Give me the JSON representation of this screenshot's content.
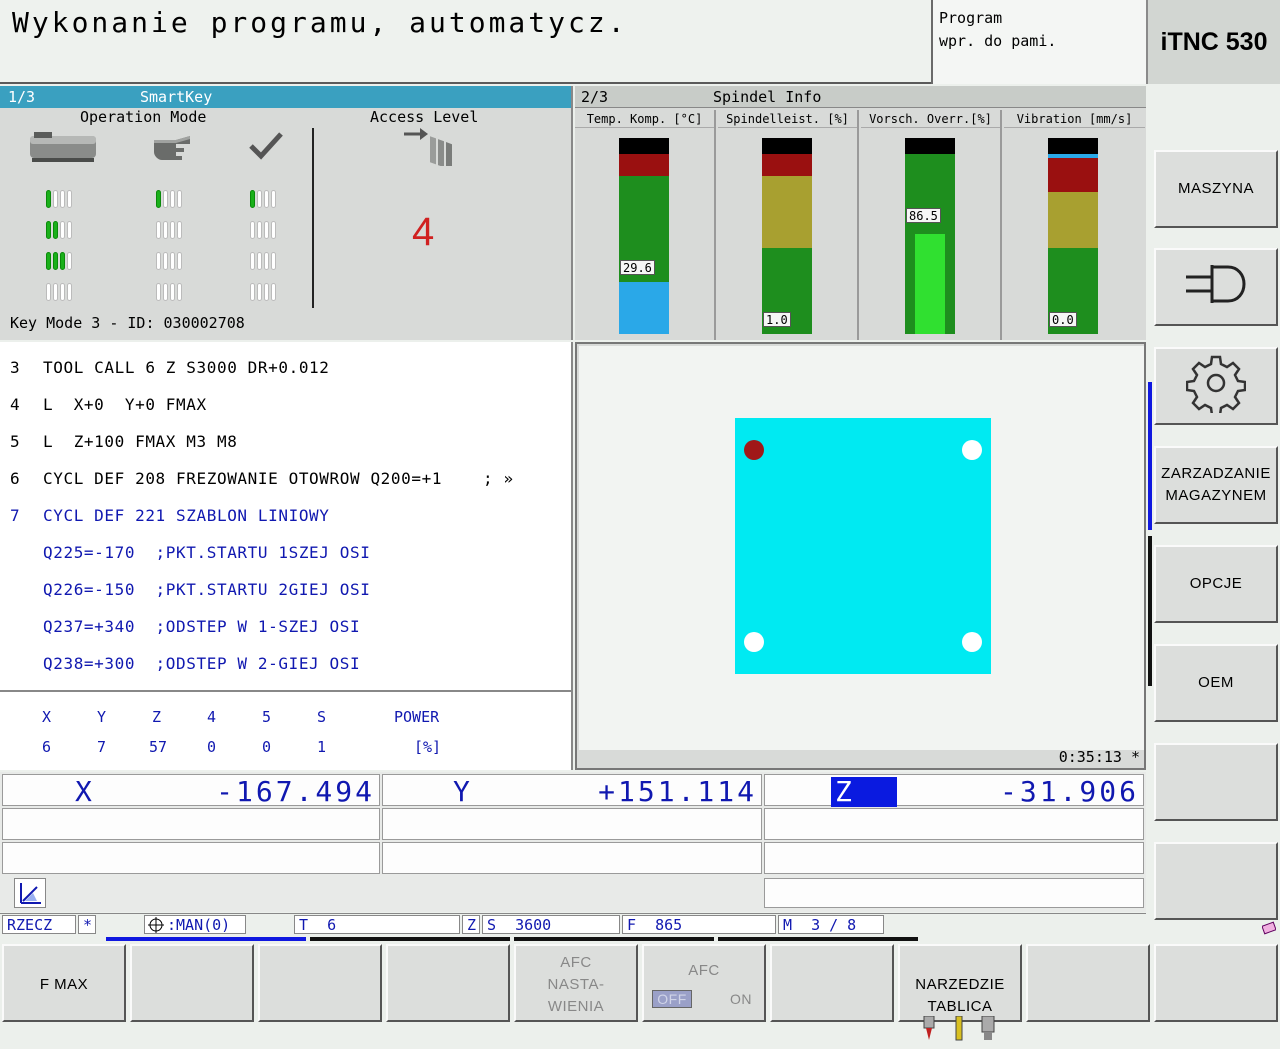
{
  "header": {
    "mode_title": "Wykonanie programu, automatycz.",
    "program_line1": "Program",
    "program_line2": "wpr. do pami.",
    "logo": "iTNC 530"
  },
  "smartkey": {
    "title_page": "1/3",
    "title": "SmartKey",
    "operation_mode_label": "Operation Mode",
    "access_level_label": "Access Level",
    "access_level_value": "4",
    "key_mode": "Key Mode 3 - ID: 030002708",
    "icons": [
      "machine-icon",
      "hand-icon",
      "check-icon",
      "key-arrow-icon"
    ]
  },
  "spindle": {
    "title_page": "2/3",
    "title": "Spindel Info",
    "gauges": [
      {
        "label": "Temp. Komp. [°C]",
        "value": "29.6"
      },
      {
        "label": "Spindelleist. [%]",
        "value": "1.0"
      },
      {
        "label": "Vorsch. Overr.[%]",
        "value": "86.5"
      },
      {
        "label": "Vibration [mm/s]",
        "value": "0.0"
      }
    ]
  },
  "program": {
    "lines": [
      {
        "no": "3",
        "text": "TOOL CALL 6 Z S3000 DR+0.012",
        "blue": false
      },
      {
        "no": "4",
        "text": "L  X+0  Y+0 FMAX",
        "blue": false
      },
      {
        "no": "5",
        "text": "L  Z+100 FMAX M3 M8",
        "blue": false
      },
      {
        "no": "6",
        "text": "CYCL DEF 208 FREZOWANIE OTOWROW Q200=+1    ; »",
        "blue": false
      },
      {
        "no": "7",
        "text": "CYCL DEF 221 SZABLON LINIOWY",
        "blue": true
      },
      {
        "no": "",
        "text": "Q225=-170  ;PKT.STARTU 1SZEJ OSI",
        "blue": true
      },
      {
        "no": "",
        "text": "Q226=-150  ;PKT.STARTU 2GIEJ OSI",
        "blue": true
      },
      {
        "no": "",
        "text": "Q237=+340  ;ODSTEP W 1-SZEJ OSI",
        "blue": true
      },
      {
        "no": "",
        "text": "Q238=+300  ;ODSTEP W 2-GIEJ OSI",
        "blue": true
      }
    ]
  },
  "load_table": {
    "headers": [
      "X",
      "Y",
      "Z",
      "4",
      "5",
      "S",
      "POWER"
    ],
    "values": [
      "6",
      "7",
      "57",
      "0",
      "0",
      "1",
      "[%]"
    ]
  },
  "graphic": {
    "runtime": "0:35:13 *"
  },
  "positions": {
    "x_label": "X",
    "x_value": "-167.494",
    "y_label": "Y",
    "y_value": "+151.114",
    "z_label": "Z",
    "z_value": "-31.906"
  },
  "status_bar": {
    "mode": "RZECZ",
    "star": "*",
    "man": ":MAN(0)",
    "tool_label": "T",
    "tool_value": "6",
    "axis": "Z",
    "spindle_label": "S",
    "spindle_value": "3600",
    "feed_label": "F",
    "feed_value": "865",
    "m_label": "M",
    "m_value": "3 / 8"
  },
  "softkeys_vertical": [
    {
      "label": "MASZYNA"
    },
    {
      "label": "",
      "icon": "plug-icon"
    },
    {
      "label": "",
      "icon": "gear-icon"
    },
    {
      "label": "ZARZADZANIE\nMAGAZYNEM"
    },
    {
      "label": "OPCJE"
    },
    {
      "label": "OEM"
    },
    {
      "label": ""
    },
    {
      "label": ""
    }
  ],
  "softkeys_horizontal": [
    {
      "label": "F MAX"
    },
    {
      "label": ""
    },
    {
      "label": ""
    },
    {
      "label": ""
    },
    {
      "label": "AFC\nNASTA-\nWIENIA",
      "disabled": true
    },
    {
      "label": "AFC",
      "off": "OFF",
      "on": "ON",
      "disabled": true
    },
    {
      "label": ""
    },
    {
      "label": "NARZEDZIE\nTABLICA"
    },
    {
      "label": ""
    },
    {
      "label": ""
    }
  ]
}
